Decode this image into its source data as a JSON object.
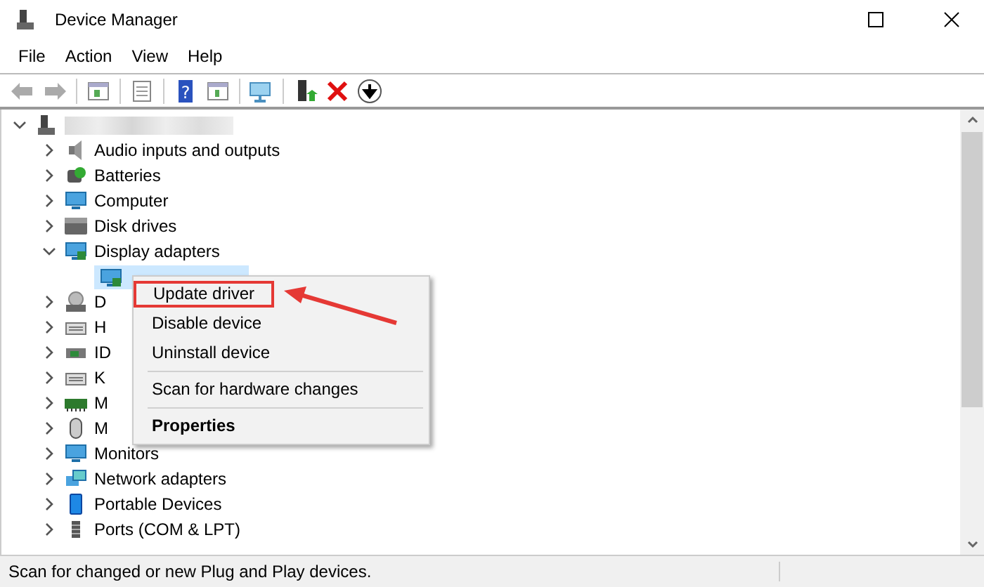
{
  "window": {
    "title": "Device Manager"
  },
  "menu": [
    "File",
    "Action",
    "View",
    "Help"
  ],
  "toolbar": [
    {
      "kind": "back",
      "disabled": true
    },
    {
      "kind": "forward",
      "disabled": true
    },
    {
      "kind": "separator"
    },
    {
      "kind": "console-tree"
    },
    {
      "kind": "separator"
    },
    {
      "kind": "properties"
    },
    {
      "kind": "separator"
    },
    {
      "kind": "help",
      "glyph": "?"
    },
    {
      "kind": "action-pane"
    },
    {
      "kind": "separator"
    },
    {
      "kind": "scan"
    },
    {
      "kind": "separator"
    },
    {
      "kind": "add-driver"
    },
    {
      "kind": "remove"
    },
    {
      "kind": "download"
    }
  ],
  "tree": [
    {
      "expanded": true,
      "children": [
        {
          "label": "Audio inputs and outputs",
          "expanded": false
        },
        {
          "label": "Batteries",
          "expanded": false
        },
        {
          "label": "Computer",
          "expanded": false
        },
        {
          "label": "Disk drives",
          "expanded": false
        },
        {
          "label": "Display adapters",
          "expanded": true,
          "children": [
            {
              "selected": true
            }
          ]
        },
        {
          "label": "D",
          "expanded": false
        },
        {
          "label": "H",
          "expanded": false
        },
        {
          "label": "ID",
          "expanded": false
        },
        {
          "label": "K",
          "expanded": false
        },
        {
          "label": "M",
          "expanded": false
        },
        {
          "label": "M",
          "expanded": false
        },
        {
          "label": "Monitors",
          "expanded": false
        },
        {
          "label": "Network adapters",
          "expanded": false
        },
        {
          "label": "Portable Devices",
          "expanded": false
        },
        {
          "label": "Ports (COM & LPT)",
          "expanded": false
        }
      ]
    }
  ],
  "context_menu": [
    {
      "kind": "item",
      "label": "Update driver",
      "callout": true,
      "default": false
    },
    {
      "kind": "item",
      "label": "Disable device",
      "callout": false,
      "default": false
    },
    {
      "kind": "item",
      "label": "Uninstall device",
      "callout": false,
      "default": false
    },
    {
      "kind": "separator"
    },
    {
      "kind": "item",
      "label": "Scan for hardware changes",
      "callout": false,
      "default": false
    },
    {
      "kind": "separator"
    },
    {
      "kind": "item",
      "label": "Properties",
      "callout": false,
      "default": true
    }
  ],
  "status_bar": "Scan for changed or new Plug and Play devices."
}
